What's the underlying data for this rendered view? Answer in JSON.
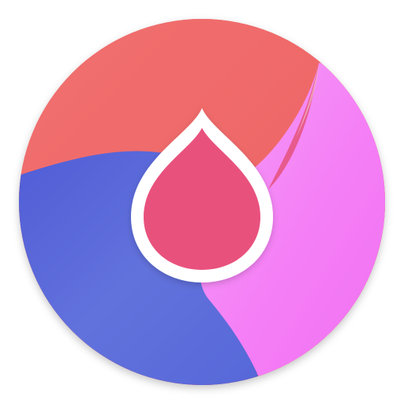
{
  "app_icon": {
    "name": "",
    "colors": {
      "background": "#ffffff",
      "top_segment": "#ef6566",
      "top_segment_shadow": "#e23b45",
      "left_segment": "#5e6fdb",
      "left_segment_dark": "#4f5bd6",
      "right_segment": "#f57ff6",
      "right_segment_light": "#f08ff3",
      "drop_fill": "#e9517d",
      "drop_outline": "#ffffff"
    },
    "icons": [
      "app-icon-circle",
      "droplet-icon"
    ]
  }
}
